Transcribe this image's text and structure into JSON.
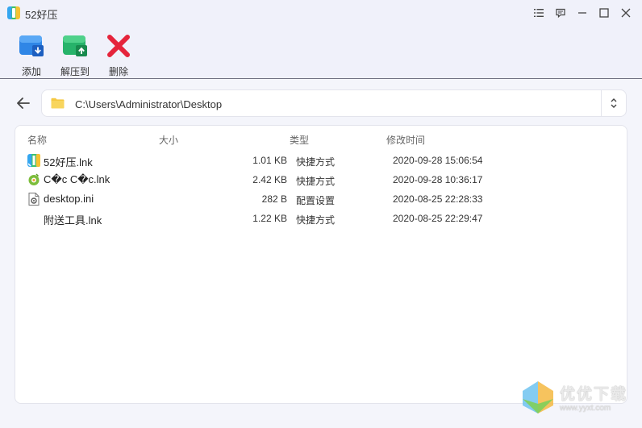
{
  "window": {
    "title": "52好压"
  },
  "toolbar": {
    "items": [
      {
        "label": "添加",
        "icon": "add-archive-icon"
      },
      {
        "label": "解压到",
        "icon": "extract-to-icon"
      },
      {
        "label": "删除",
        "icon": "delete-icon"
      }
    ]
  },
  "address": {
    "path": "C:\\Users\\Administrator\\Desktop"
  },
  "file_list": {
    "columns": [
      "名称",
      "大小",
      "类型",
      "修改时间"
    ],
    "rows": [
      {
        "name": "52好压.lnk",
        "size": "1.01 KB",
        "type": "快捷方式",
        "modified": "2020-09-28 15:06:54",
        "icon": "haozip-app-icon"
      },
      {
        "name": "C�c C�c.lnk",
        "size": "2.42 KB",
        "type": "快捷方式",
        "modified": "2020-09-28 10:36:17",
        "icon": "coccoc-browser-icon"
      },
      {
        "name": "desktop.ini",
        "size": "282 B",
        "type": "配置设置",
        "modified": "2020-08-25 22:28:33",
        "icon": "settings-file-icon"
      },
      {
        "name": "附送工具.lnk",
        "size": "1.22 KB",
        "type": "快捷方式",
        "modified": "2020-08-25 22:29:47",
        "icon": "none"
      }
    ]
  },
  "watermark": {
    "brand": "优优下载",
    "url": "www.yyxt.com"
  },
  "colors": {
    "background": "#f4f5fb",
    "titlebar": "#f0f1fa",
    "panel": "#ffffff",
    "add_icon": "#2f86e6",
    "extract_icon": "#27b36a",
    "delete_icon": "#e5243b",
    "folder_icon": "#f5c842"
  }
}
